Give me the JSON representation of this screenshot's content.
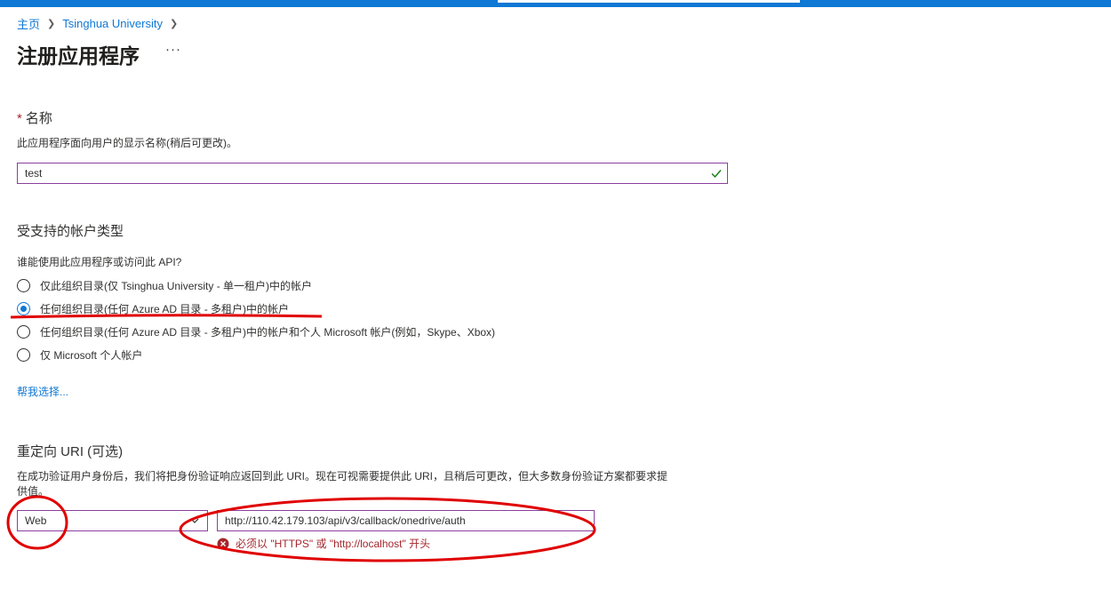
{
  "breadcrumb": {
    "home": "主页",
    "tenant": "Tsinghua University"
  },
  "page": {
    "title": "注册应用程序",
    "more": "···"
  },
  "name_section": {
    "label": "名称",
    "required_mark": "*",
    "help": "此应用程序面向用户的显示名称(稍后可更改)。",
    "value": "test"
  },
  "account_types": {
    "heading": "受支持的帐户类型",
    "question": "谁能使用此应用程序或访问此 API?",
    "options": [
      {
        "label": "仅此组织目录(仅 Tsinghua University - 单一租户)中的帐户",
        "selected": false
      },
      {
        "label": "任何组织目录(任何 Azure AD 目录 - 多租户)中的帐户",
        "selected": true
      },
      {
        "label": "任何组织目录(任何 Azure AD 目录 - 多租户)中的帐户和个人 Microsoft 帐户(例如，Skype、Xbox)",
        "selected": false
      },
      {
        "label": "仅 Microsoft 个人帐户",
        "selected": false
      }
    ],
    "help_link": "帮我选择..."
  },
  "redirect": {
    "heading": "重定向 URI (可选)",
    "help_line1": "在成功验证用户身份后，我们将把身份验证响应返回到此 URI。现在可视需要提供此 URI，且稍后可更改，但大多数身份验证方案都要求提",
    "help_line2": "供值。",
    "platform": "Web",
    "uri_value": "http://110.42.179.103/api/v3/callback/onedrive/auth",
    "error": "必须以 \"HTTPS\" 或 \"http://localhost\" 开头"
  },
  "colors": {
    "accent": "#0f78d4",
    "error": "#a4262c",
    "input_border": "#8a3f9e",
    "annotation": "#e00000",
    "valid": "#107c10"
  }
}
